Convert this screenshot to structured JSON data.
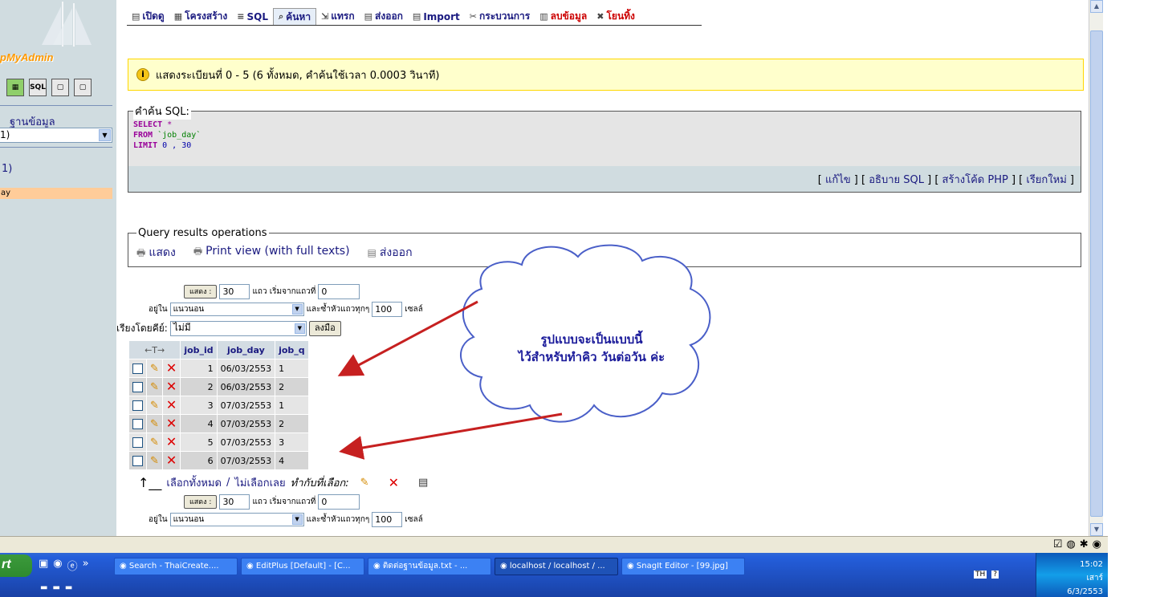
{
  "sidebar": {
    "logo_text": "pMyAdmin",
    "icon_labels": [
      "",
      "SQL",
      "",
      ""
    ],
    "db_label": "ฐานข้อมูล",
    "db_select_value": "1)",
    "db_name": "1)",
    "table_item": "ay"
  },
  "tabs": [
    {
      "label": "เปิดดู",
      "icon": "browse-icon"
    },
    {
      "label": "โครงสร้าง",
      "icon": "structure-icon"
    },
    {
      "label": "SQL",
      "icon": "sql-icon"
    },
    {
      "label": "ค้นหา",
      "icon": "search-icon"
    },
    {
      "label": "แทรก",
      "icon": "insert-icon"
    },
    {
      "label": "ส่งออก",
      "icon": "export-icon"
    },
    {
      "label": "Import",
      "icon": "import-icon"
    },
    {
      "label": "กระบวนการ",
      "icon": "operations-icon"
    },
    {
      "label": "ลบข้อมูล",
      "icon": "empty-icon"
    },
    {
      "label": "โยนทิ้ง",
      "icon": "drop-icon"
    }
  ],
  "notice": "แสดงระเบียนที่ 0 - 5 (6 ทั้งหมด, คำค้นใช้เวลา 0.0003 วินาที)",
  "sql": {
    "legend": "คำค้น SQL:",
    "kw_select": "SELECT",
    "select_rest": " *",
    "kw_from": "FROM",
    "from_rest": " `job_day`",
    "kw_limit": "LIMIT",
    "limit_rest": " 0 , 30",
    "links": {
      "edit": "แก้ไข",
      "explain": "อธิบาย SQL",
      "php": "สร้างโค้ด PHP",
      "refresh": "เรียกใหม่"
    }
  },
  "ops": {
    "legend": "Query results operations",
    "show": "แสดง",
    "print": "Print view (with full texts)",
    "export": "ส่งออก"
  },
  "nav_top": {
    "show_btn": "แสดง :",
    "rows": "30",
    "rows_label": "แถว เริ่มจากแถวที่",
    "start": "0",
    "in_label": "อยู่ใน",
    "mode": "แนวนอน",
    "repeat_label": "และซ้ำหัวแถวทุกๆ",
    "repeat": "100",
    "cells": "เซลล์"
  },
  "sort": {
    "label": "เรียงโดยคีย์:",
    "value": "ไม่มี",
    "button": "ลงมือ"
  },
  "table": {
    "arrows": "←T→",
    "headers": [
      "job_id",
      "job_day",
      "job_q"
    ],
    "rows": [
      [
        "1",
        "06/03/2553",
        "1"
      ],
      [
        "2",
        "06/03/2553",
        "2"
      ],
      [
        "3",
        "07/03/2553",
        "1"
      ],
      [
        "4",
        "07/03/2553",
        "2"
      ],
      [
        "5",
        "07/03/2553",
        "3"
      ],
      [
        "6",
        "07/03/2553",
        "4"
      ]
    ]
  },
  "select_all": {
    "check": "เลือกทั้งหมด",
    "uncheck": "ไม่เลือกเลย",
    "with": "ทำกับที่เลือก:"
  },
  "annotation": {
    "line1": "รูปแบบจะเป็นแบบนี้",
    "line2": "ไว้สำหรับทำคิว วันต่อวัน ค่ะ"
  },
  "taskbar": {
    "start": "rt",
    "tasks": [
      "Search - ThaiCreate....",
      "EditPlus [Default] - [C...",
      "ติดต่อฐานข้อมูล.txt - ...",
      "localhost / localhost / ...",
      "SnagIt Editor - [99.jpg]"
    ],
    "lang": "TH",
    "time": "15:02",
    "day": "เสาร์",
    "date": "6/3/2553"
  }
}
